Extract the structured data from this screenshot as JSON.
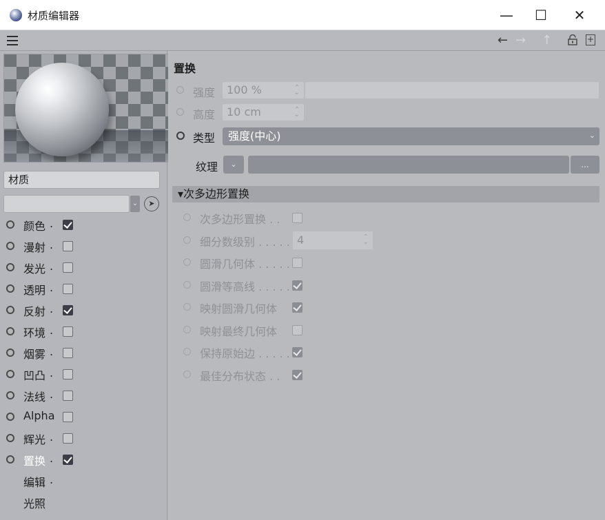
{
  "window": {
    "title": "材质编辑器",
    "minimize": "—",
    "maximize": "☐",
    "close": "✕"
  },
  "toolbar": {
    "back": "←",
    "forward": "→",
    "up": "↑",
    "new": "+"
  },
  "material": {
    "name": "材质",
    "channels": [
      {
        "label": "颜色",
        "dots": ".",
        "checked": true
      },
      {
        "label": "漫射",
        "dots": ".",
        "checked": false
      },
      {
        "label": "发光",
        "dots": ".",
        "checked": false
      },
      {
        "label": "透明",
        "dots": ".",
        "checked": false
      },
      {
        "label": "反射",
        "dots": ".",
        "checked": true
      },
      {
        "label": "环境",
        "dots": ".",
        "checked": false
      },
      {
        "label": "烟雾",
        "dots": ".",
        "checked": false
      },
      {
        "label": "凹凸",
        "dots": ".",
        "checked": false
      },
      {
        "label": "法线",
        "dots": ".",
        "checked": false
      },
      {
        "label": "Alpha",
        "dots": "",
        "checked": false
      },
      {
        "label": "辉光",
        "dots": ".",
        "checked": false
      },
      {
        "label": "置换",
        "dots": ".",
        "checked": true,
        "active": true
      }
    ],
    "extras": [
      {
        "label": "编辑",
        "dots": "."
      },
      {
        "label": "光照",
        "dots": ""
      }
    ]
  },
  "displacement": {
    "section_title": "置换",
    "strength_label": "强度",
    "strength_value": "100 %",
    "height_label": "高度",
    "height_value": "10 cm",
    "type_label": "类型",
    "type_value": "强度(中心)",
    "texture_label": "纹理",
    "texture_more": "...",
    "spin": "⌃⌄",
    "chevron": "⌄"
  },
  "subpoly": {
    "header": "▾次多边形置换",
    "items": [
      {
        "label": "次多边形置换 . .",
        "kind": "checkbox",
        "checked": false
      },
      {
        "label": "细分数级别 . . . . .",
        "kind": "number",
        "value": "4"
      },
      {
        "label": "圆滑几何体 . . . . .",
        "kind": "checkbox",
        "checked": false
      },
      {
        "label": "圆滑等高线 . . . . .",
        "kind": "checkbox",
        "checked": true
      },
      {
        "label": "映射圆滑几何体",
        "kind": "checkbox",
        "checked": true
      },
      {
        "label": "映射最终几何体",
        "kind": "checkbox",
        "checked": false
      },
      {
        "label": "保持原始边 . . . . .",
        "kind": "checkbox",
        "checked": true
      },
      {
        "label": "最佳分布状态 . .",
        "kind": "checkbox",
        "checked": true
      }
    ]
  }
}
